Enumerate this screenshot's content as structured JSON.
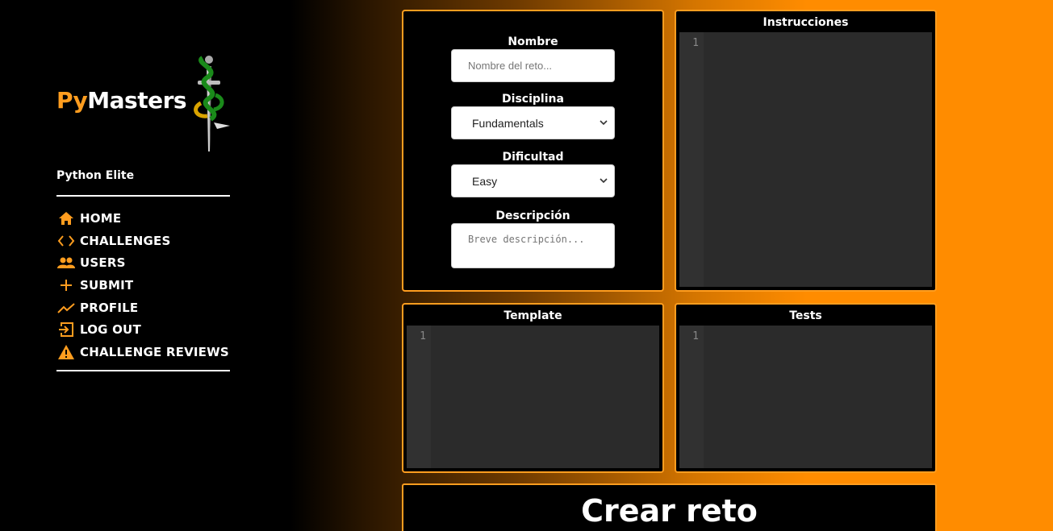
{
  "brand": {
    "py": "Py",
    "masters": "Masters"
  },
  "user": {
    "name": "Python Elite"
  },
  "nav": {
    "items": [
      {
        "label": "HOME",
        "icon": "home-icon"
      },
      {
        "label": "CHALLENGES",
        "icon": "code-icon"
      },
      {
        "label": "USERS",
        "icon": "users-icon"
      },
      {
        "label": "SUBMIT",
        "icon": "plus-icon"
      },
      {
        "label": "PROFILE",
        "icon": "trend-icon"
      },
      {
        "label": "LOG OUT",
        "icon": "logout-icon"
      },
      {
        "label": "CHALLENGE REVIEWS",
        "icon": "warning-icon"
      }
    ]
  },
  "form": {
    "name_label": "Nombre",
    "name_placeholder": "Nombre del reto...",
    "discipline_label": "Disciplina",
    "discipline_value": "Fundamentals",
    "difficulty_label": "Dificultad",
    "difficulty_value": "Easy",
    "description_label": "Descripción",
    "description_placeholder": "Breve descripción..."
  },
  "editors": {
    "instructions": {
      "title": "Instrucciones",
      "line": "1"
    },
    "template": {
      "title": "Template",
      "line": "1"
    },
    "tests": {
      "title": "Tests",
      "line": "1"
    }
  },
  "submit": {
    "label": "Crear reto"
  },
  "colors": {
    "accent": "#ff9d1f",
    "editor_bg": "#2b2b2b",
    "gutter_bg": "#313131"
  }
}
